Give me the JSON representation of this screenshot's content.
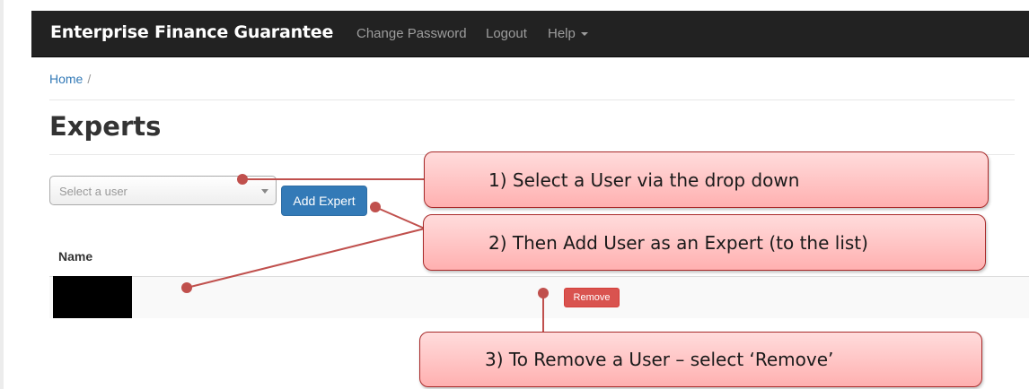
{
  "navbar": {
    "brand": "Enterprise Finance Guarantee",
    "links": {
      "change_password": "Change Password",
      "logout": "Logout",
      "help": "Help"
    }
  },
  "breadcrumb": {
    "home": "Home",
    "separator": "/"
  },
  "page": {
    "title": "Experts"
  },
  "form": {
    "select_placeholder": "Select a user",
    "add_button": "Add Expert"
  },
  "table": {
    "header_name": "Name",
    "rows": [
      {
        "name": "",
        "remove_label": "Remove"
      }
    ]
  },
  "callouts": [
    "1)  Select a User via the drop down",
    "2)  Then Add User as an Expert (to the list)",
    "3)  To Remove a User – select ‘Remove’"
  ],
  "colors": {
    "navbar": "#222222",
    "primary": "#337ab7",
    "danger": "#d9534f",
    "callout_border": "#a82a2a",
    "connector": "#c0504d"
  }
}
